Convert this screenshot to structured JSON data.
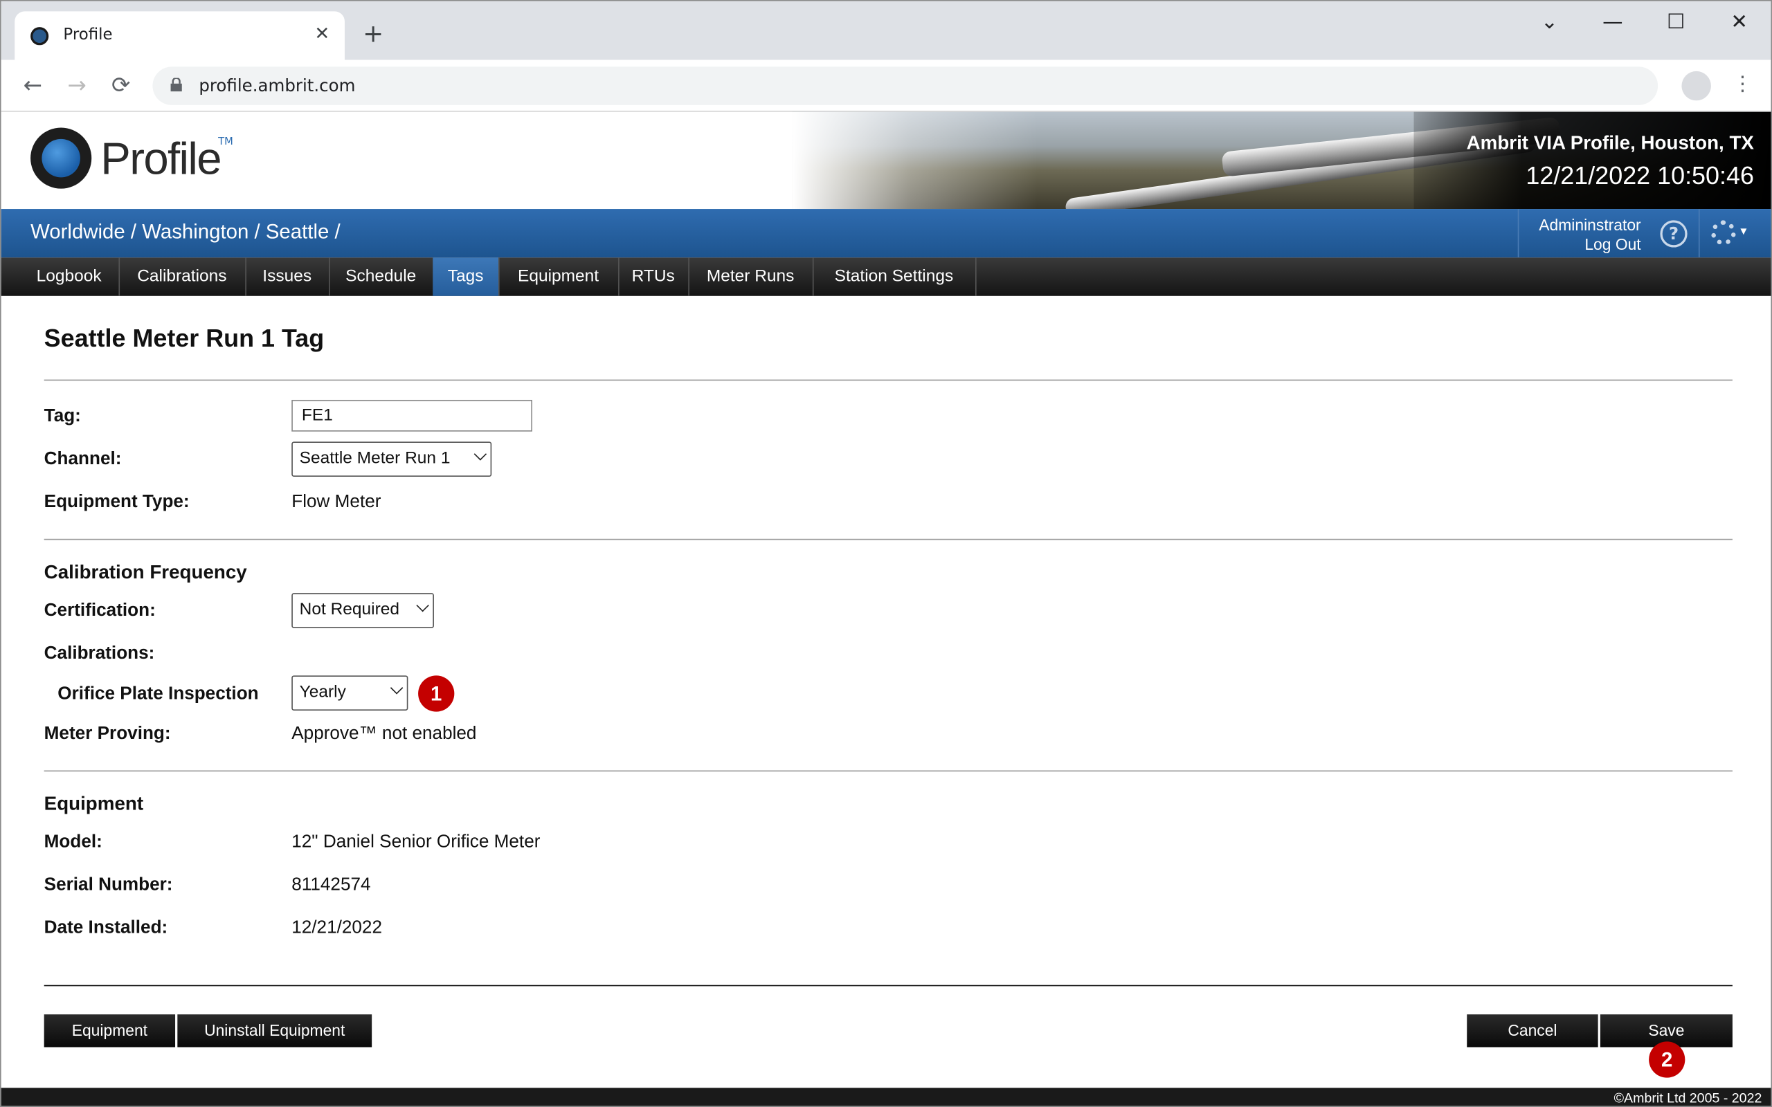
{
  "browser": {
    "tab_title": "Profile",
    "tab_close": "✕",
    "new_tab": "+",
    "url": "profile.ambrit.com",
    "controls": {
      "dropdown": "⌄",
      "minimize": "—",
      "maximize": "☐",
      "close": "✕"
    },
    "nav": {
      "back": "←",
      "forward": "→",
      "reload": "⟳",
      "menu": "⋮"
    }
  },
  "header": {
    "logo_text": "Profile",
    "logo_tm": "TM",
    "site_title": "Ambrit VIA Profile, Houston, TX",
    "clock": "12/21/2022 10:50:46"
  },
  "crumbs": {
    "path": "Worldwide / Washington / Seattle /",
    "user": "Admininstrator",
    "logout": "Log Out",
    "help": "?",
    "gear_caret": "▾"
  },
  "nav": {
    "items": [
      "Logbook",
      "Calibrations",
      "Issues",
      "Schedule",
      "Tags",
      "Equipment",
      "RTUs",
      "Meter Runs",
      "Station Settings"
    ],
    "active": "Tags"
  },
  "form": {
    "title": "Seattle Meter Run 1 Tag",
    "tag_label": "Tag:",
    "tag_value": "FE1",
    "channel_label": "Channel:",
    "channel_value": "Seattle Meter Run 1",
    "equip_type_label": "Equipment Type:",
    "equip_type_value": "Flow Meter",
    "cal_freq_heading": "Calibration Frequency",
    "cert_label": "Certification:",
    "cert_value": "Not Required",
    "calibrations_label": "Calibrations:",
    "orifice_label": "Orifice Plate Inspection",
    "orifice_value": "Yearly",
    "proving_label": "Meter Proving:",
    "proving_value": "Approve™ not enabled",
    "equipment_heading": "Equipment",
    "model_label": "Model:",
    "model_value": "12\" Daniel Senior Orifice Meter",
    "serial_label": "Serial Number:",
    "serial_value": "81142574",
    "date_label": "Date Installed:",
    "date_value": "12/21/2022"
  },
  "buttons": {
    "equipment": "Equipment",
    "uninstall": "Uninstall Equipment",
    "cancel": "Cancel",
    "save": "Save"
  },
  "badges": {
    "one": "1",
    "two": "2"
  },
  "footer": "©Ambrit Ltd 2005 - 2022"
}
